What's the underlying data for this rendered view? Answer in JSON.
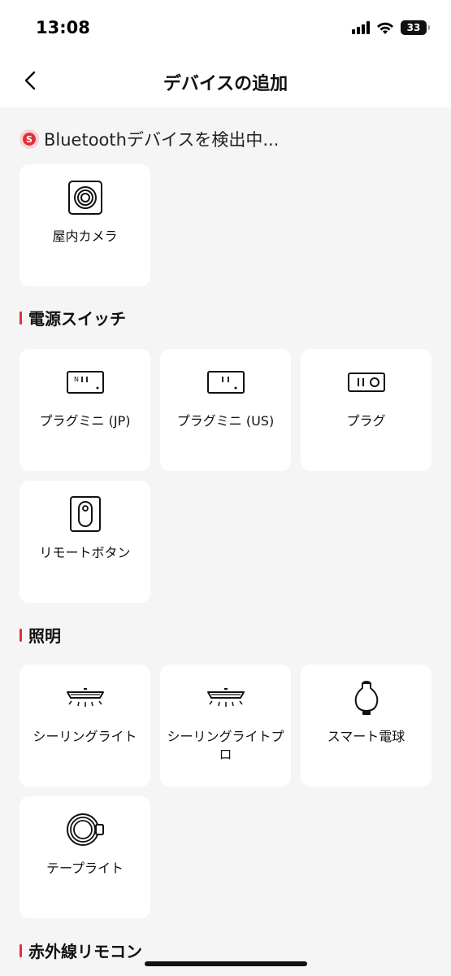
{
  "status": {
    "time": "13:08",
    "battery": "33"
  },
  "nav": {
    "title": "デバイスの追加"
  },
  "scan": {
    "badge": "S",
    "text": "Bluetoothデバイスを検出中..."
  },
  "bluetooth_devices": [
    {
      "label": "屋内カメラ",
      "icon": "camera-icon"
    }
  ],
  "sections": {
    "power": {
      "title": "電源スイッチ",
      "items": [
        {
          "label": "プラグミニ (JP)",
          "icon": "plug-mini-jp-icon"
        },
        {
          "label": "プラグミニ (US)",
          "icon": "plug-mini-us-icon"
        },
        {
          "label": "プラグ",
          "icon": "plug-icon"
        },
        {
          "label": "リモートボタン",
          "icon": "remote-button-icon"
        }
      ]
    },
    "lighting": {
      "title": "照明",
      "items": [
        {
          "label": "シーリングライト",
          "icon": "ceiling-light-icon"
        },
        {
          "label": "シーリングライトプロ",
          "icon": "ceiling-light-pro-icon"
        },
        {
          "label": "スマート電球",
          "icon": "smart-bulb-icon"
        },
        {
          "label": "テープライト",
          "icon": "tape-light-icon"
        }
      ]
    },
    "ir": {
      "title": "赤外線リモコン"
    }
  },
  "colors": {
    "accent": "#e0303c",
    "background": "#f5f5f5",
    "card": "#ffffff"
  }
}
